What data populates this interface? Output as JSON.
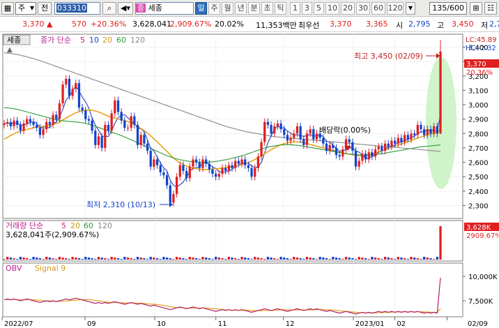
{
  "toolbar": {
    "market_type": "주",
    "prev_label": "전",
    "stock_code": "033310",
    "stock_name_badge": "증",
    "stock_name": "세종",
    "periods": [
      "일",
      "주",
      "월",
      "년",
      "분",
      "초",
      "틱"
    ],
    "intervals": [
      "1",
      "3",
      "5",
      "10",
      "20",
      "30",
      "60",
      "120"
    ],
    "count_value": "135/600"
  },
  "infobar": {
    "price": "3,370",
    "change": "570",
    "change_pct": "+20.36%",
    "volume": "3,628,041",
    "volume_pct": "2,909.67%",
    "turnover_pct": "20.02%",
    "amount": "11,353백만",
    "best_ask_label": "최우선",
    "best_ask": "3,370",
    "best_bid": "3,365",
    "open_label": "시",
    "open": "2,795",
    "high_label": "고",
    "high": "3,450",
    "low_label": "저",
    "low": "2,795"
  },
  "price_panel": {
    "stock_tab": "세종",
    "legend": {
      "prefix": "종가 단순",
      "ma": [
        "5",
        "10",
        "20",
        "60",
        "120"
      ]
    },
    "corner": [
      "LC:45.89",
      "HC:-2.32"
    ],
    "current_price_tag": "3,370",
    "current_pct_tag": "20.36%",
    "high_annotation": "최고 3,450 (02/09)",
    "low_annotation": "최저 2,310 (10/13)",
    "dividend_annotation": "배당락(0.00%)"
  },
  "volume_panel": {
    "legend_prefix": "거래량 단순",
    "ma": [
      "5",
      "20",
      "60",
      "120"
    ],
    "summary": "3,628,041주(2,909.67%)",
    "value_tag": "3,628K",
    "pct_tag": "2909.67%"
  },
  "obv_panel": {
    "legend": "OBV",
    "signal": "Signal 9",
    "ticks": [
      "10,000K",
      "7,500K"
    ]
  },
  "colors": {
    "up": "#e02020",
    "down": "#1144cc",
    "ma5": "#2a3fbf",
    "ma20": "#e5a21a",
    "ma60": "#2e9a3a",
    "ma120": "#888888"
  },
  "chart_data": [
    {
      "type": "candlestick",
      "title": "",
      "y_ticks": [
        3400,
        3300,
        3200,
        3100,
        3000,
        2900,
        2800,
        2700,
        2600,
        2500,
        2400,
        2300
      ],
      "ylim": [
        2220,
        3480
      ],
      "x_labels": [
        "2022/07",
        "09",
        "10",
        "11",
        "12",
        "2023/01",
        "02",
        "02/09"
      ],
      "close": [
        2870,
        2880,
        2850,
        2890,
        2860,
        2820,
        2870,
        2900,
        2880,
        2860,
        2840,
        2790,
        2830,
        2880,
        2860,
        2930,
        2900,
        3010,
        3140,
        3180,
        3060,
        3110,
        3150,
        2980,
        2960,
        2900,
        2890,
        2820,
        2720,
        2780,
        2700,
        2860,
        2820,
        2940,
        3030,
        2950,
        2890,
        2840,
        2840,
        2920,
        2860,
        2720,
        2790,
        2730,
        2680,
        2570,
        2620,
        2580,
        2530,
        2510,
        2440,
        2320,
        2380,
        2500,
        2580,
        2540,
        2490,
        2570,
        2620,
        2600,
        2560,
        2620,
        2590,
        2550,
        2520,
        2500,
        2520,
        2560,
        2540,
        2580,
        2560,
        2610,
        2590,
        2620,
        2580,
        2560,
        2500,
        2560,
        2640,
        2740,
        2880,
        2860,
        2800,
        2850,
        2870,
        2830,
        2790,
        2750,
        2770,
        2800,
        2850,
        2760,
        2720,
        2800,
        2830,
        2760,
        2800,
        2770,
        2730,
        2680,
        2720,
        2700,
        2650,
        2640,
        2690,
        2760,
        2740,
        2680,
        2570,
        2610,
        2660,
        2620,
        2670,
        2640,
        2690,
        2710,
        2680,
        2730,
        2710,
        2750,
        2730,
        2770,
        2740,
        2790,
        2760,
        2800,
        2790,
        2860,
        2830,
        2790,
        2830,
        2800,
        2850,
        2800,
        3370
      ],
      "series": [
        {
          "name": "5",
          "values": [
            2870,
            2872,
            2868,
            2874,
            2870,
            2860,
            2858,
            2868,
            2876,
            2882,
            2870,
            2842,
            2838,
            2840,
            2842,
            2868,
            2880,
            2916,
            2968,
            3032,
            3058,
            3098,
            3128,
            3096,
            3052,
            3020,
            2976,
            2910,
            2858,
            2822,
            2782,
            2780,
            2780,
            2820,
            2870,
            2910,
            2926,
            2930,
            2910,
            2888,
            2870,
            2836,
            2834,
            2812,
            2756,
            2698,
            2678,
            2636,
            2596,
            2562,
            2540,
            2476,
            2440,
            2430,
            2444,
            2464,
            2498,
            2536,
            2560,
            2564,
            2568,
            2592,
            2598,
            2588,
            2568,
            2558,
            2536,
            2530,
            2532,
            2540,
            2552,
            2570,
            2580,
            2596,
            2592,
            2594,
            2574,
            2564,
            2568,
            2600,
            2664,
            2736,
            2784,
            2828,
            2850,
            2842,
            2838,
            2818,
            2802,
            2788,
            2792,
            2786,
            2780,
            2786,
            2792,
            2784,
            2782,
            2792,
            2778,
            2748,
            2740,
            2720,
            2696,
            2678,
            2680,
            2688,
            2698,
            2702,
            2680,
            2670,
            2652,
            2628,
            2626,
            2642,
            2648,
            2668,
            2678,
            2690,
            2704,
            2714,
            2720,
            2738,
            2740,
            2752,
            2758,
            2772,
            2782,
            2800,
            2810,
            2814,
            2822,
            2824,
            2818,
            2818,
            2930
          ]
        },
        {
          "name": "20",
          "values": [
            2760,
            2774,
            2786,
            2798,
            2808,
            2816,
            2822,
            2828,
            2834,
            2840,
            2844,
            2846,
            2848,
            2852,
            2856,
            2862,
            2870,
            2880,
            2894,
            2908,
            2920,
            2932,
            2944,
            2952,
            2958,
            2962,
            2964,
            2962,
            2956,
            2950,
            2940,
            2930,
            2920,
            2914,
            2908,
            2902,
            2896,
            2890,
            2882,
            2874,
            2864,
            2850,
            2836,
            2820,
            2802,
            2784,
            2764,
            2742,
            2720,
            2698,
            2676,
            2652,
            2630,
            2612,
            2596,
            2584,
            2574,
            2566,
            2560,
            2556,
            2552,
            2550,
            2550,
            2552,
            2554,
            2556,
            2558,
            2560,
            2562,
            2566,
            2570,
            2574,
            2578,
            2584,
            2590,
            2598,
            2608,
            2620,
            2632,
            2646,
            2660,
            2674,
            2688,
            2700,
            2712,
            2722,
            2730,
            2736,
            2740,
            2742,
            2742,
            2740,
            2736,
            2730,
            2724,
            2718,
            2712,
            2706,
            2700,
            2694,
            2688,
            2682,
            2676,
            2670,
            2664,
            2660,
            2656,
            2652,
            2648,
            2646,
            2646,
            2648,
            2652,
            2658,
            2664,
            2672,
            2680,
            2688,
            2696,
            2704,
            2712,
            2720,
            2728,
            2736,
            2744,
            2752,
            2760,
            2768,
            2776,
            2784,
            2790,
            2796,
            2800,
            2806,
            2830
          ]
        },
        {
          "name": "60",
          "values": [
            2980,
            2978,
            2976,
            2972,
            2968,
            2962,
            2956,
            2950,
            2944,
            2938,
            2932,
            2926,
            2920,
            2914,
            2908,
            2902,
            2896,
            2892,
            2888,
            2886,
            2884,
            2882,
            2880,
            2878,
            2874,
            2870,
            2864,
            2858,
            2850,
            2842,
            2834,
            2826,
            2818,
            2810,
            2802,
            2794,
            2786,
            2776,
            2766,
            2756,
            2746,
            2736,
            2726,
            2716,
            2706,
            2696,
            2686,
            2676,
            2666,
            2656,
            2646,
            2638,
            2630,
            2624,
            2618,
            2614,
            2610,
            2606,
            2604,
            2602,
            2600,
            2600,
            2600,
            2602,
            2604,
            2606,
            2610,
            2614,
            2618,
            2622,
            2628,
            2634,
            2640,
            2646,
            2652,
            2660,
            2668,
            2676,
            2684,
            2692,
            2700,
            2706,
            2710,
            2714,
            2718,
            2720,
            2722,
            2722,
            2722,
            2720,
            2718,
            2716,
            2712,
            2708,
            2704,
            2700,
            2696,
            2692,
            2688,
            2684,
            2680,
            2676,
            2672,
            2668,
            2664,
            2660,
            2658,
            2656,
            2654,
            2652,
            2650,
            2650,
            2650,
            2652,
            2654,
            2656,
            2660,
            2664,
            2668,
            2672,
            2676,
            2680,
            2684,
            2688,
            2692,
            2696,
            2700,
            2704,
            2708,
            2710,
            2712,
            2714,
            2716,
            2718,
            2722
          ]
        },
        {
          "name": "120",
          "values": [
            3360,
            3358,
            3356,
            3352,
            3348,
            3344,
            3338,
            3332,
            3326,
            3320,
            3314,
            3306,
            3298,
            3290,
            3282,
            3274,
            3266,
            3258,
            3250,
            3242,
            3234,
            3226,
            3218,
            3210,
            3202,
            3194,
            3186,
            3178,
            3170,
            3162,
            3154,
            3146,
            3138,
            3130,
            3122,
            3114,
            3106,
            3098,
            3090,
            3082,
            3074,
            3066,
            3058,
            3050,
            3042,
            3034,
            3026,
            3018,
            3010,
            3002,
            2994,
            2986,
            2978,
            2970,
            2962,
            2954,
            2946,
            2938,
            2930,
            2922,
            2914,
            2906,
            2898,
            2890,
            2882,
            2874,
            2866,
            2858,
            2850,
            2844,
            2838,
            2832,
            2826,
            2820,
            2814,
            2810,
            2806,
            2802,
            2798,
            2794,
            2790,
            2786,
            2782,
            2778,
            2776,
            2774,
            2772,
            2770,
            2768,
            2766,
            2764,
            2762,
            2760,
            2758,
            2756,
            2754,
            2752,
            2750,
            2748,
            2746,
            2744,
            2742,
            2740,
            2738,
            2736,
            2734,
            2732,
            2730,
            2728,
            2726,
            2724,
            2722,
            2720,
            2718,
            2716,
            2714,
            2712,
            2710,
            2708,
            2706,
            2704,
            2702,
            2700,
            2698,
            2696,
            2694,
            2692,
            2690,
            2688,
            2686,
            2684,
            2682,
            2680,
            2678,
            2676
          ]
        }
      ]
    }
  ]
}
